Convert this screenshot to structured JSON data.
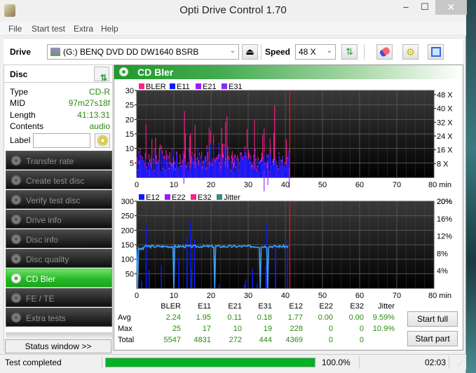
{
  "window": {
    "title": "Opti Drive Control 1.70",
    "minimize": "–",
    "maximize": "☐",
    "close": "✕"
  },
  "menu": [
    "File",
    "Start test",
    "Extra",
    "Help"
  ],
  "toolbar": {
    "drive_label": "Drive",
    "drive_value": "(G:)  BENQ DVD DD DW1640 BSRB",
    "speed_label": "Speed",
    "speed_value": "48 X"
  },
  "disc": {
    "heading": "Disc",
    "rows": [
      {
        "key": "Type",
        "value": "CD-R"
      },
      {
        "key": "MID",
        "value": "97m27s18f"
      },
      {
        "key": "Length",
        "value": "41:13.31"
      },
      {
        "key": "Contents",
        "value": "audio"
      }
    ],
    "label_key": "Label",
    "label_value": ""
  },
  "nav": [
    {
      "label": "Transfer rate",
      "active": false
    },
    {
      "label": "Create test disc",
      "active": false
    },
    {
      "label": "Verify test disc",
      "active": false
    },
    {
      "label": "Drive info",
      "active": false
    },
    {
      "label": "Disc info",
      "active": false
    },
    {
      "label": "Disc quality",
      "active": false
    },
    {
      "label": "CD Bler",
      "active": true
    },
    {
      "label": "FE / TE",
      "active": false
    },
    {
      "label": "Extra tests",
      "active": false
    }
  ],
  "status_window_button": "Status window >>",
  "panel_title": "CD Bler",
  "chart_data": [
    {
      "type": "bar",
      "title": "CD Bler upper",
      "legend": [
        {
          "name": "BLER",
          "color": "#ff1f8f"
        },
        {
          "name": "E11",
          "color": "#0a1aff"
        },
        {
          "name": "E21",
          "color": "#9a1aff"
        },
        {
          "name": "E31",
          "color": "#8a2aff"
        }
      ],
      "xlabel": "min",
      "xlim": [
        0,
        80
      ],
      "x_ticks": [
        "0",
        "10",
        "20",
        "30",
        "40",
        "50",
        "60",
        "70",
        "80 min"
      ],
      "ylim": [
        0,
        30
      ],
      "y_ticks": [
        "5",
        "10",
        "15",
        "20",
        "25",
        "30"
      ],
      "y2_ticks": [
        "8 X",
        "16 X",
        "24 X",
        "32 X",
        "40 X",
        "48 X"
      ],
      "marker_x": 41.2,
      "series_summary": {
        "BLER_max": 25,
        "E11_max": 17,
        "E21_max": 10,
        "E31_max": 19,
        "data_end_min": 41.2
      }
    },
    {
      "type": "bar",
      "title": "CD Bler lower",
      "legend": [
        {
          "name": "E12",
          "color": "#0a1aff"
        },
        {
          "name": "E22",
          "color": "#9a1aff"
        },
        {
          "name": "E32",
          "color": "#ff1f8f"
        },
        {
          "name": "Jitter",
          "color": "#3a8a80"
        }
      ],
      "xlabel": "min",
      "xlim": [
        0,
        80
      ],
      "x_ticks": [
        "0",
        "10",
        "20",
        "30",
        "40",
        "50",
        "60",
        "70",
        "80 min"
      ],
      "ylim": [
        0,
        300
      ],
      "y_ticks": [
        "50",
        "100",
        "150",
        "200",
        "250",
        "300"
      ],
      "y2_ticks": [
        "4%",
        "8%",
        "12%",
        "16%",
        "20%"
      ],
      "marker_x": 41.2,
      "e12_spikes": [
        [
          0.1,
          68
        ],
        [
          1.2,
          25
        ],
        [
          2.4,
          215
        ],
        [
          3.2,
          62
        ],
        [
          6.5,
          80
        ],
        [
          11.2,
          105
        ],
        [
          13.4,
          177
        ],
        [
          14.4,
          228
        ],
        [
          14.6,
          65
        ],
        [
          15.4,
          168
        ],
        [
          22,
          12
        ],
        [
          28.8,
          12
        ],
        [
          29.2,
          30
        ],
        [
          31,
          67
        ],
        [
          32.2,
          12
        ],
        [
          34.6,
          80
        ],
        [
          34.9,
          222
        ],
        [
          37.2,
          153
        ],
        [
          40.4,
          168
        ]
      ],
      "jitter_line": {
        "baseline_pct": 9.6,
        "dips_min": [
          0.2,
          10.1,
          20.9,
          33.3,
          35.2
        ]
      }
    }
  ],
  "stats": {
    "columns": [
      "BLER",
      "E11",
      "E21",
      "E31",
      "E12",
      "E22",
      "E32",
      "Jitter"
    ],
    "rows": [
      {
        "label": "Avg",
        "values": [
          "2.24",
          "1.95",
          "0.11",
          "0.18",
          "1.77",
          "0.00",
          "0.00",
          "9.59%"
        ]
      },
      {
        "label": "Max",
        "values": [
          "25",
          "17",
          "10",
          "19",
          "228",
          "0",
          "0",
          "10.9%"
        ]
      },
      {
        "label": "Total",
        "values": [
          "5547",
          "4831",
          "272",
          "444",
          "4369",
          "0",
          "0",
          ""
        ]
      }
    ]
  },
  "buttons": {
    "start_full": "Start full",
    "start_part": "Start part"
  },
  "status": {
    "text": "Test completed",
    "progress_pct": 100,
    "progress_label": "100.0%",
    "time": "02:03"
  }
}
